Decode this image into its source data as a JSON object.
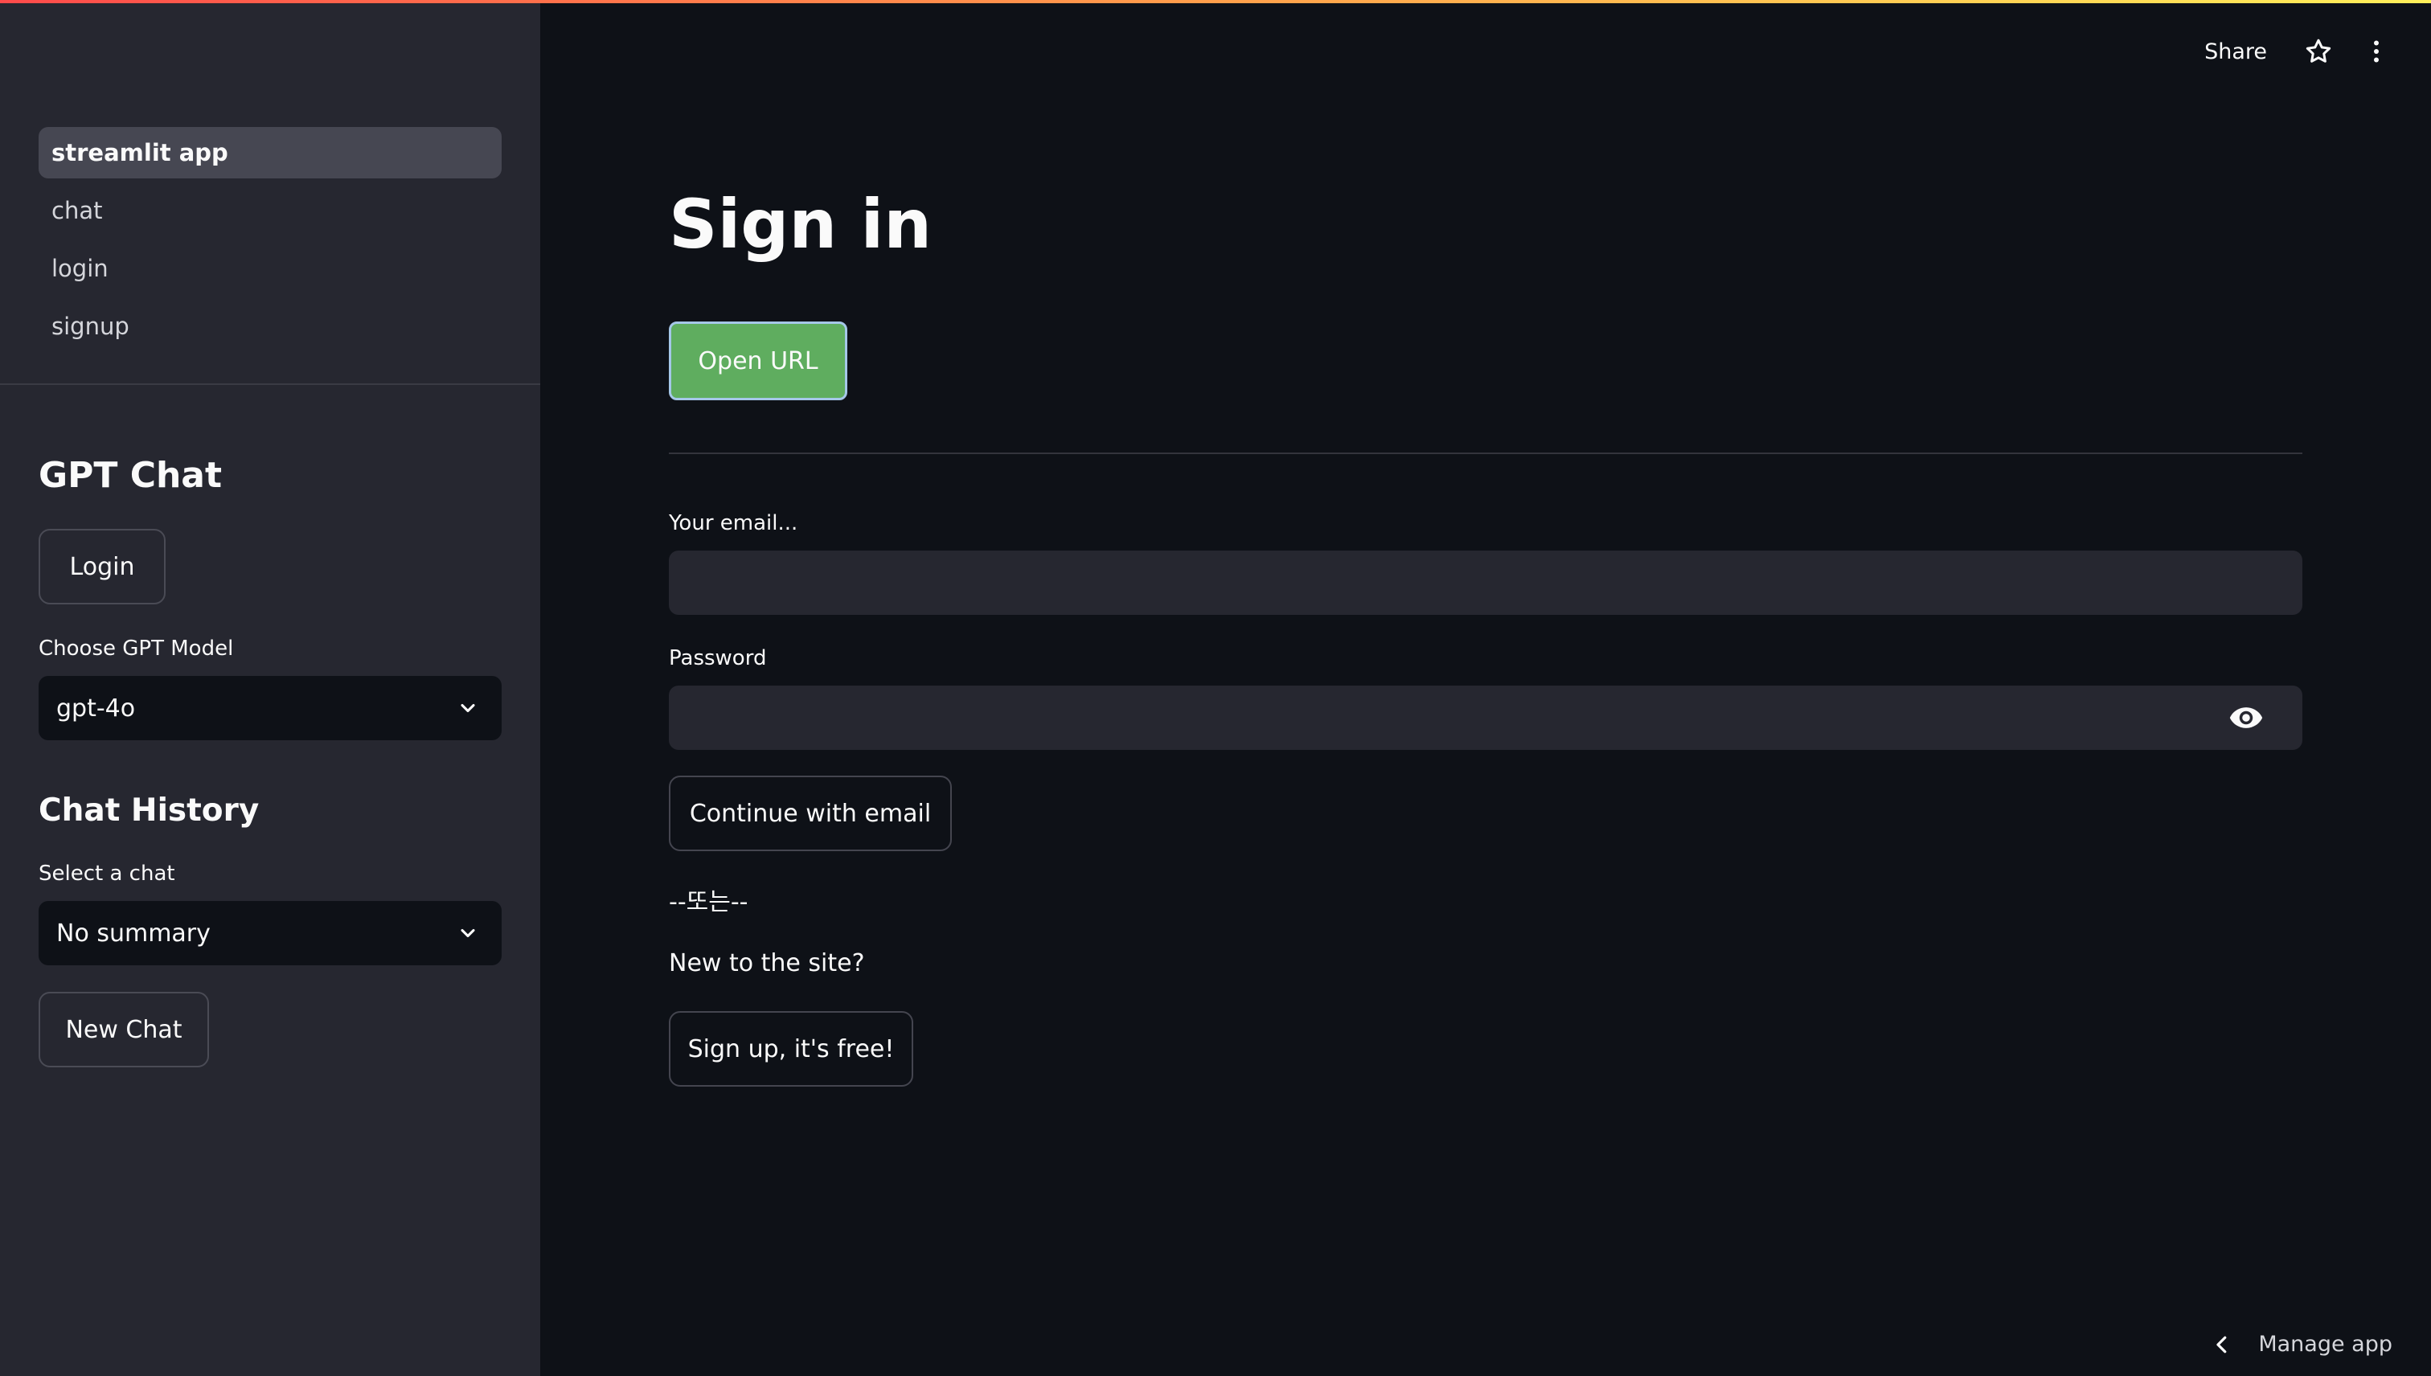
{
  "nav": {
    "items": [
      {
        "label": "streamlit app",
        "active": true
      },
      {
        "label": "chat",
        "active": false
      },
      {
        "label": "login",
        "active": false
      },
      {
        "label": "signup",
        "active": false
      }
    ]
  },
  "sidebar": {
    "gpt_heading": "GPT Chat",
    "login_button": "Login",
    "model_label": "Choose GPT Model",
    "model_value": "gpt-4o",
    "history_heading": "Chat History",
    "chat_label": "Select a chat",
    "chat_value": "No summary",
    "new_chat_button": "New Chat"
  },
  "header": {
    "share": "Share",
    "icons": [
      "star-icon",
      "more-vert-icon"
    ]
  },
  "main": {
    "title": "Sign in",
    "open_url_button": "Open URL",
    "email_label": "Your email...",
    "email_value": "",
    "password_label": "Password",
    "password_value": "",
    "continue_button": "Continue with email",
    "or_text": "--또는--",
    "new_text": "New to the site?",
    "signup_button": "Sign up, it's free!"
  },
  "footer": {
    "manage_app": "Manage app"
  },
  "colors": {
    "background": "#0e1117",
    "sidebar": "#262730",
    "primary_button": "#5fad5f",
    "input": "#262730"
  }
}
